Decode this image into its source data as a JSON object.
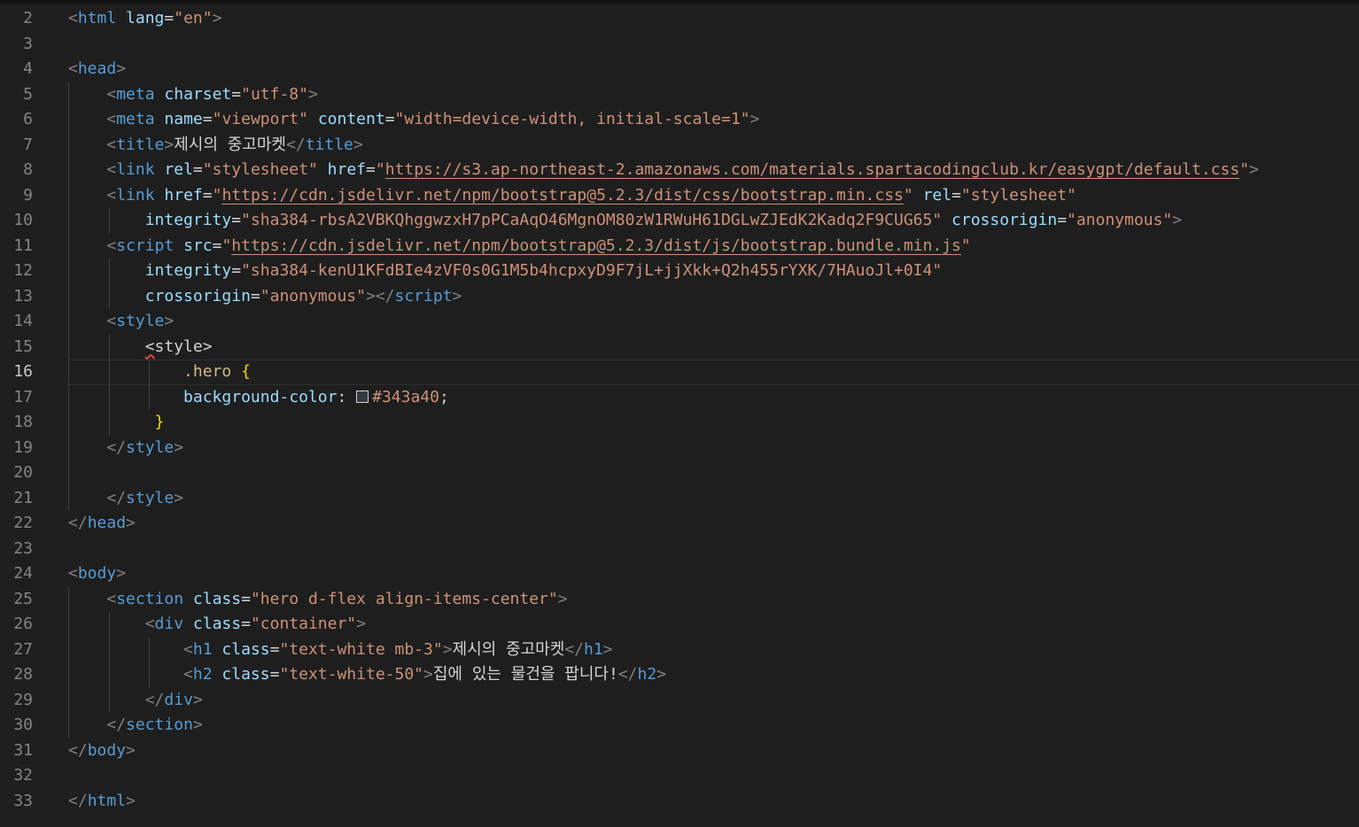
{
  "editor": {
    "language": "html",
    "active_line": "16",
    "lines": [
      {
        "n": "2",
        "segs": [
          {
            "t": "<",
            "c": "t-p"
          },
          {
            "t": "html",
            "c": "t-tag"
          },
          {
            "t": " ",
            "c": "t-txt"
          },
          {
            "t": "lang",
            "c": "t-attr"
          },
          {
            "t": "=",
            "c": "t-eq"
          },
          {
            "t": "\"en\"",
            "c": "t-str"
          },
          {
            "t": ">",
            "c": "t-p"
          }
        ]
      },
      {
        "n": "3",
        "segs": []
      },
      {
        "n": "4",
        "segs": [
          {
            "t": "<",
            "c": "t-p"
          },
          {
            "t": "head",
            "c": "t-tag"
          },
          {
            "t": ">",
            "c": "t-p"
          }
        ]
      },
      {
        "n": "5",
        "segs": [
          {
            "t": "    ",
            "c": "t-txt"
          },
          {
            "t": "<",
            "c": "t-p"
          },
          {
            "t": "meta",
            "c": "t-tag"
          },
          {
            "t": " ",
            "c": "t-txt"
          },
          {
            "t": "charset",
            "c": "t-attr"
          },
          {
            "t": "=",
            "c": "t-eq"
          },
          {
            "t": "\"utf-8\"",
            "c": "t-str"
          },
          {
            "t": ">",
            "c": "t-p"
          }
        ]
      },
      {
        "n": "6",
        "segs": [
          {
            "t": "    ",
            "c": "t-txt"
          },
          {
            "t": "<",
            "c": "t-p"
          },
          {
            "t": "meta",
            "c": "t-tag"
          },
          {
            "t": " ",
            "c": "t-txt"
          },
          {
            "t": "name",
            "c": "t-attr"
          },
          {
            "t": "=",
            "c": "t-eq"
          },
          {
            "t": "\"viewport\"",
            "c": "t-str"
          },
          {
            "t": " ",
            "c": "t-txt"
          },
          {
            "t": "content",
            "c": "t-attr"
          },
          {
            "t": "=",
            "c": "t-eq"
          },
          {
            "t": "\"width=device-width, initial-scale=1\"",
            "c": "t-str"
          },
          {
            "t": ">",
            "c": "t-p"
          }
        ]
      },
      {
        "n": "7",
        "segs": [
          {
            "t": "    ",
            "c": "t-txt"
          },
          {
            "t": "<",
            "c": "t-p"
          },
          {
            "t": "title",
            "c": "t-tag"
          },
          {
            "t": ">",
            "c": "t-p"
          },
          {
            "t": "제시의 중고마켓",
            "c": "t-txt"
          },
          {
            "t": "</",
            "c": "t-p"
          },
          {
            "t": "title",
            "c": "t-tag"
          },
          {
            "t": ">",
            "c": "t-p"
          }
        ]
      },
      {
        "n": "8",
        "segs": [
          {
            "t": "    ",
            "c": "t-txt"
          },
          {
            "t": "<",
            "c": "t-p"
          },
          {
            "t": "link",
            "c": "t-tag"
          },
          {
            "t": " ",
            "c": "t-txt"
          },
          {
            "t": "rel",
            "c": "t-attr"
          },
          {
            "t": "=",
            "c": "t-eq"
          },
          {
            "t": "\"stylesheet\"",
            "c": "t-str"
          },
          {
            "t": " ",
            "c": "t-txt"
          },
          {
            "t": "href",
            "c": "t-attr"
          },
          {
            "t": "=",
            "c": "t-eq"
          },
          {
            "t": "\"",
            "c": "t-str"
          },
          {
            "t": "https://s3.ap-northeast-2.amazonaws.com/materials.spartacodingclub.kr/easygpt/default.css",
            "c": "t-url"
          },
          {
            "t": "\"",
            "c": "t-str"
          },
          {
            "t": ">",
            "c": "t-p"
          }
        ]
      },
      {
        "n": "9",
        "segs": [
          {
            "t": "    ",
            "c": "t-txt"
          },
          {
            "t": "<",
            "c": "t-p"
          },
          {
            "t": "link",
            "c": "t-tag"
          },
          {
            "t": " ",
            "c": "t-txt"
          },
          {
            "t": "href",
            "c": "t-attr"
          },
          {
            "t": "=",
            "c": "t-eq"
          },
          {
            "t": "\"",
            "c": "t-str"
          },
          {
            "t": "https://cdn.jsdelivr.net/npm/bootstrap@5.2.3/dist/css/bootstrap.min.css",
            "c": "t-url"
          },
          {
            "t": "\"",
            "c": "t-str"
          },
          {
            "t": " ",
            "c": "t-txt"
          },
          {
            "t": "rel",
            "c": "t-attr"
          },
          {
            "t": "=",
            "c": "t-eq"
          },
          {
            "t": "\"stylesheet\"",
            "c": "t-str"
          }
        ]
      },
      {
        "n": "10",
        "segs": [
          {
            "t": "        ",
            "c": "t-txt"
          },
          {
            "t": "integrity",
            "c": "t-attr"
          },
          {
            "t": "=",
            "c": "t-eq"
          },
          {
            "t": "\"sha384-rbsA2VBKQhggwzxH7pPCaAqO46MgnOM80zW1RWuH61DGLwZJEdK2Kadq2F9CUG65\"",
            "c": "t-str"
          },
          {
            "t": " ",
            "c": "t-txt"
          },
          {
            "t": "crossorigin",
            "c": "t-attr"
          },
          {
            "t": "=",
            "c": "t-eq"
          },
          {
            "t": "\"anonymous\"",
            "c": "t-str"
          },
          {
            "t": ">",
            "c": "t-p"
          }
        ]
      },
      {
        "n": "11",
        "segs": [
          {
            "t": "    ",
            "c": "t-txt"
          },
          {
            "t": "<",
            "c": "t-p"
          },
          {
            "t": "script",
            "c": "t-tag"
          },
          {
            "t": " ",
            "c": "t-txt"
          },
          {
            "t": "src",
            "c": "t-attr"
          },
          {
            "t": "=",
            "c": "t-eq"
          },
          {
            "t": "\"",
            "c": "t-str"
          },
          {
            "t": "https://cdn.jsdelivr.net/npm/bootstrap@5.2.3/dist/js/bootstrap.bundle.min.js",
            "c": "t-url"
          },
          {
            "t": "\"",
            "c": "t-str"
          }
        ]
      },
      {
        "n": "12",
        "segs": [
          {
            "t": "        ",
            "c": "t-txt"
          },
          {
            "t": "integrity",
            "c": "t-attr"
          },
          {
            "t": "=",
            "c": "t-eq"
          },
          {
            "t": "\"sha384-kenU1KFdBIe4zVF0s0G1M5b4hcpxyD9F7jL+jjXkk+Q2h455rYXK/7HAuoJl+0I4\"",
            "c": "t-str"
          }
        ]
      },
      {
        "n": "13",
        "segs": [
          {
            "t": "        ",
            "c": "t-txt"
          },
          {
            "t": "crossorigin",
            "c": "t-attr"
          },
          {
            "t": "=",
            "c": "t-eq"
          },
          {
            "t": "\"anonymous\"",
            "c": "t-str"
          },
          {
            "t": "></",
            "c": "t-p"
          },
          {
            "t": "script",
            "c": "t-tag"
          },
          {
            "t": ">",
            "c": "t-p"
          }
        ]
      },
      {
        "n": "14",
        "segs": [
          {
            "t": "    ",
            "c": "t-txt"
          },
          {
            "t": "<",
            "c": "t-p"
          },
          {
            "t": "style",
            "c": "t-tag"
          },
          {
            "t": ">",
            "c": "t-p"
          }
        ]
      },
      {
        "n": "15",
        "segs": [
          {
            "t": "        ",
            "c": "t-txt"
          },
          {
            "t": "<",
            "c": "t-txt squiggle"
          },
          {
            "t": "style>",
            "c": "t-txt"
          }
        ]
      },
      {
        "n": "16",
        "segs": [
          {
            "t": "            ",
            "c": "t-txt"
          },
          {
            "t": ".hero",
            "c": "t-sel"
          },
          {
            "t": " ",
            "c": "t-txt"
          },
          {
            "t": "{",
            "c": "t-brace"
          }
        ]
      },
      {
        "n": "17",
        "segs": [
          {
            "t": "            ",
            "c": "t-txt"
          },
          {
            "t": "background-color",
            "c": "t-prop"
          },
          {
            "t": ": ",
            "c": "t-txt"
          },
          {
            "t": "",
            "c": "swatch"
          },
          {
            "t": "#343a40",
            "c": "t-val"
          },
          {
            "t": ";",
            "c": "t-txt"
          }
        ]
      },
      {
        "n": "18",
        "segs": [
          {
            "t": "         ",
            "c": "t-txt"
          },
          {
            "t": "}",
            "c": "t-brace"
          }
        ]
      },
      {
        "n": "19",
        "segs": [
          {
            "t": "    ",
            "c": "t-txt"
          },
          {
            "t": "</",
            "c": "t-p"
          },
          {
            "t": "style",
            "c": "t-tag"
          },
          {
            "t": ">",
            "c": "t-p"
          }
        ]
      },
      {
        "n": "20",
        "segs": []
      },
      {
        "n": "21",
        "segs": [
          {
            "t": "    ",
            "c": "t-txt"
          },
          {
            "t": "</",
            "c": "t-p"
          },
          {
            "t": "style",
            "c": "t-tag"
          },
          {
            "t": ">",
            "c": "t-p"
          }
        ]
      },
      {
        "n": "22",
        "segs": [
          {
            "t": "</",
            "c": "t-p"
          },
          {
            "t": "head",
            "c": "t-tag"
          },
          {
            "t": ">",
            "c": "t-p"
          }
        ]
      },
      {
        "n": "23",
        "segs": []
      },
      {
        "n": "24",
        "segs": [
          {
            "t": "<",
            "c": "t-p"
          },
          {
            "t": "body",
            "c": "t-tag"
          },
          {
            "t": ">",
            "c": "t-p"
          }
        ]
      },
      {
        "n": "25",
        "segs": [
          {
            "t": "    ",
            "c": "t-txt"
          },
          {
            "t": "<",
            "c": "t-p"
          },
          {
            "t": "section",
            "c": "t-tag"
          },
          {
            "t": " ",
            "c": "t-txt"
          },
          {
            "t": "class",
            "c": "t-attr"
          },
          {
            "t": "=",
            "c": "t-eq"
          },
          {
            "t": "\"hero d-flex align-items-center\"",
            "c": "t-str"
          },
          {
            "t": ">",
            "c": "t-p"
          }
        ]
      },
      {
        "n": "26",
        "segs": [
          {
            "t": "        ",
            "c": "t-txt"
          },
          {
            "t": "<",
            "c": "t-p"
          },
          {
            "t": "div",
            "c": "t-tag"
          },
          {
            "t": " ",
            "c": "t-txt"
          },
          {
            "t": "class",
            "c": "t-attr"
          },
          {
            "t": "=",
            "c": "t-eq"
          },
          {
            "t": "\"container\"",
            "c": "t-str"
          },
          {
            "t": ">",
            "c": "t-p"
          }
        ]
      },
      {
        "n": "27",
        "segs": [
          {
            "t": "            ",
            "c": "t-txt"
          },
          {
            "t": "<",
            "c": "t-p"
          },
          {
            "t": "h1",
            "c": "t-tag"
          },
          {
            "t": " ",
            "c": "t-txt"
          },
          {
            "t": "class",
            "c": "t-attr"
          },
          {
            "t": "=",
            "c": "t-eq"
          },
          {
            "t": "\"text-white mb-3\"",
            "c": "t-str"
          },
          {
            "t": ">",
            "c": "t-p"
          },
          {
            "t": "제시의 중고마켓",
            "c": "t-txt"
          },
          {
            "t": "</",
            "c": "t-p"
          },
          {
            "t": "h1",
            "c": "t-tag"
          },
          {
            "t": ">",
            "c": "t-p"
          }
        ]
      },
      {
        "n": "28",
        "segs": [
          {
            "t": "            ",
            "c": "t-txt"
          },
          {
            "t": "<",
            "c": "t-p"
          },
          {
            "t": "h2",
            "c": "t-tag"
          },
          {
            "t": " ",
            "c": "t-txt"
          },
          {
            "t": "class",
            "c": "t-attr"
          },
          {
            "t": "=",
            "c": "t-eq"
          },
          {
            "t": "\"text-white-50\"",
            "c": "t-str"
          },
          {
            "t": ">",
            "c": "t-p"
          },
          {
            "t": "집에 있는 물건을 팝니다!",
            "c": "t-txt"
          },
          {
            "t": "</",
            "c": "t-p"
          },
          {
            "t": "h2",
            "c": "t-tag"
          },
          {
            "t": ">",
            "c": "t-p"
          }
        ]
      },
      {
        "n": "29",
        "segs": [
          {
            "t": "        ",
            "c": "t-txt"
          },
          {
            "t": "</",
            "c": "t-p"
          },
          {
            "t": "div",
            "c": "t-tag"
          },
          {
            "t": ">",
            "c": "t-p"
          }
        ]
      },
      {
        "n": "30",
        "segs": [
          {
            "t": "    ",
            "c": "t-txt"
          },
          {
            "t": "</",
            "c": "t-p"
          },
          {
            "t": "section",
            "c": "t-tag"
          },
          {
            "t": ">",
            "c": "t-p"
          }
        ]
      },
      {
        "n": "31",
        "segs": [
          {
            "t": "</",
            "c": "t-p"
          },
          {
            "t": "body",
            "c": "t-tag"
          },
          {
            "t": ">",
            "c": "t-p"
          }
        ]
      },
      {
        "n": "32",
        "segs": []
      },
      {
        "n": "33",
        "segs": [
          {
            "t": "</",
            "c": "t-p"
          },
          {
            "t": "html",
            "c": "t-tag"
          },
          {
            "t": ">",
            "c": "t-p"
          }
        ]
      }
    ]
  }
}
